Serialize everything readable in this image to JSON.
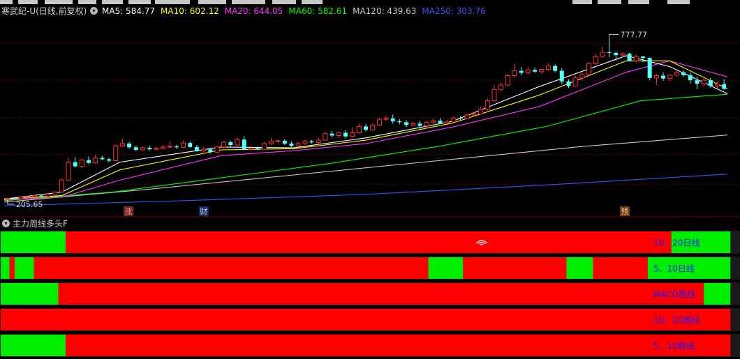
{
  "stock": {
    "title": "寒武纪-U(日线,前复权)",
    "toggle_glyph": "▾"
  },
  "ma_values": [
    {
      "key": "ma5",
      "label": "MA5: 584.77",
      "color": "#ffffff"
    },
    {
      "key": "ma10",
      "label": "MA10: 602.12",
      "color": "#ffff00"
    },
    {
      "key": "ma20",
      "label": "MA20: 644.05",
      "color": "#ff33ff"
    },
    {
      "key": "ma60",
      "label": "MA60: 582.61",
      "color": "#00ff00"
    },
    {
      "key": "ma120",
      "label": "MA120: 439.63",
      "color": "#c8c8c8"
    },
    {
      "key": "ma250",
      "label": "MA250: 303.76",
      "color": "#3355ff"
    }
  ],
  "colors": {
    "up": "#ff3232",
    "down": "#54ffff",
    "signal_red": "#ff0000",
    "signal_green": "#00ee00",
    "signal_label": "#1a1aff",
    "grid": "#7a0000"
  },
  "chart_data": {
    "type": "candlestick",
    "ylim": [
      190,
      840
    ],
    "high_label": "777.77",
    "low_label": "205.65",
    "candles": [
      [
        216,
        218,
        212,
        220
      ],
      [
        218,
        217,
        214,
        221
      ],
      [
        217,
        222,
        215,
        224
      ],
      [
        222,
        224,
        220,
        226
      ],
      [
        224,
        228,
        222,
        230
      ],
      [
        228,
        225,
        223,
        231
      ],
      [
        225,
        233,
        224,
        236
      ],
      [
        233,
        240,
        231,
        242
      ],
      [
        240,
        282,
        238,
        290
      ],
      [
        282,
        345,
        280,
        360
      ],
      [
        345,
        330,
        326,
        362
      ],
      [
        330,
        352,
        324,
        358
      ],
      [
        352,
        342,
        338,
        365
      ],
      [
        342,
        360,
        340,
        371
      ],
      [
        360,
        355,
        352,
        367
      ],
      [
        355,
        350,
        345,
        360
      ],
      [
        350,
        402,
        348,
        408
      ],
      [
        402,
        410,
        398,
        428
      ],
      [
        410,
        397,
        392,
        416
      ],
      [
        397,
        388,
        384,
        402
      ],
      [
        388,
        395,
        384,
        400
      ],
      [
        395,
        390,
        386,
        403
      ],
      [
        390,
        393,
        387,
        398
      ],
      [
        393,
        398,
        390,
        405
      ],
      [
        398,
        400,
        394,
        418
      ],
      [
        400,
        397,
        392,
        406
      ],
      [
        397,
        412,
        394,
        420
      ],
      [
        412,
        398,
        395,
        418
      ],
      [
        398,
        384,
        380,
        405
      ],
      [
        384,
        390,
        380,
        400
      ],
      [
        390,
        380,
        376,
        395
      ],
      [
        380,
        398,
        378,
        403
      ],
      [
        398,
        415,
        392,
        420
      ],
      [
        415,
        405,
        398,
        420
      ],
      [
        405,
        424,
        402,
        432
      ],
      [
        424,
        390,
        386,
        436
      ],
      [
        390,
        394,
        384,
        402
      ],
      [
        394,
        390,
        386,
        400
      ],
      [
        390,
        410,
        388,
        416
      ],
      [
        410,
        418,
        405,
        430
      ],
      [
        418,
        420,
        413,
        424
      ],
      [
        420,
        410,
        405,
        425
      ],
      [
        410,
        402,
        398,
        418
      ],
      [
        402,
        410,
        398,
        418
      ],
      [
        410,
        418,
        405,
        424
      ],
      [
        418,
        414,
        410,
        422
      ],
      [
        414,
        422,
        410,
        432
      ],
      [
        422,
        445,
        420,
        450
      ],
      [
        445,
        438,
        432,
        455
      ],
      [
        438,
        448,
        430,
        452
      ],
      [
        448,
        435,
        428,
        458
      ],
      [
        435,
        448,
        432,
        468
      ],
      [
        448,
        470,
        445,
        480
      ],
      [
        470,
        458,
        452,
        478
      ],
      [
        458,
        475,
        455,
        480
      ],
      [
        475,
        495,
        472,
        500
      ],
      [
        495,
        498,
        490,
        508
      ],
      [
        498,
        488,
        480,
        512
      ],
      [
        488,
        485,
        478,
        495
      ],
      [
        485,
        475,
        468,
        492
      ],
      [
        475,
        480,
        470,
        488
      ],
      [
        480,
        472,
        460,
        490
      ],
      [
        472,
        485,
        462,
        490
      ],
      [
        485,
        490,
        478,
        498
      ],
      [
        490,
        482,
        478,
        500
      ],
      [
        482,
        486,
        480,
        494
      ],
      [
        486,
        500,
        484,
        505
      ],
      [
        500,
        498,
        492,
        506
      ],
      [
        498,
        510,
        496,
        515
      ],
      [
        510,
        514,
        505,
        520
      ],
      [
        514,
        530,
        512,
        540
      ],
      [
        530,
        560,
        525,
        570
      ],
      [
        560,
        600,
        555,
        615
      ],
      [
        600,
        615,
        592,
        625
      ],
      [
        615,
        648,
        610,
        655
      ],
      [
        648,
        665,
        640,
        690
      ],
      [
        665,
        658,
        650,
        678
      ],
      [
        658,
        668,
        652,
        680
      ],
      [
        668,
        662,
        658,
        676
      ],
      [
        662,
        670,
        655,
        672
      ],
      [
        670,
        682,
        665,
        690
      ],
      [
        682,
        665,
        660,
        688
      ],
      [
        665,
        628,
        618,
        675
      ],
      [
        628,
        612,
        605,
        635
      ],
      [
        612,
        640,
        610,
        650
      ],
      [
        640,
        652,
        632,
        660
      ],
      [
        652,
        690,
        648,
        695
      ],
      [
        690,
        715,
        685,
        725
      ],
      [
        715,
        730,
        710,
        750
      ],
      [
        730,
        728,
        712,
        778
      ],
      [
        728,
        720,
        700,
        732
      ],
      [
        720,
        725,
        712,
        730
      ],
      [
        725,
        700,
        698,
        728
      ],
      [
        700,
        715,
        694,
        722
      ],
      [
        715,
        710,
        695,
        718
      ],
      [
        710,
        640,
        632,
        712
      ],
      [
        640,
        648,
        615,
        655
      ],
      [
        648,
        638,
        630,
        660
      ],
      [
        638,
        650,
        630,
        654
      ],
      [
        650,
        660,
        645,
        665
      ],
      [
        660,
        650,
        645,
        668
      ],
      [
        650,
        632,
        620,
        660
      ],
      [
        632,
        620,
        600,
        645
      ],
      [
        620,
        632,
        610,
        640
      ],
      [
        632,
        612,
        606,
        640
      ],
      [
        612,
        618,
        605,
        628
      ],
      [
        618,
        602,
        598,
        635
      ]
    ],
    "ma_lines": {
      "ma5": [
        [
          0,
          216
        ],
        [
          0.08,
          240
        ],
        [
          0.16,
          345
        ],
        [
          0.3,
          398
        ],
        [
          0.4,
          395
        ],
        [
          0.5,
          430
        ],
        [
          0.62,
          488
        ],
        [
          0.74,
          610
        ],
        [
          0.86,
          718
        ],
        [
          0.92,
          680
        ],
        [
          1.0,
          585
        ]
      ],
      "ma10": [
        [
          0,
          215
        ],
        [
          0.08,
          228
        ],
        [
          0.16,
          318
        ],
        [
          0.3,
          388
        ],
        [
          0.4,
          392
        ],
        [
          0.5,
          422
        ],
        [
          0.62,
          482
        ],
        [
          0.74,
          580
        ],
        [
          0.86,
          700
        ],
        [
          0.92,
          700
        ],
        [
          1.0,
          602
        ]
      ],
      "ma20": [
        [
          0,
          213
        ],
        [
          0.08,
          222
        ],
        [
          0.16,
          282
        ],
        [
          0.3,
          368
        ],
        [
          0.4,
          385
        ],
        [
          0.5,
          410
        ],
        [
          0.62,
          468
        ],
        [
          0.74,
          540
        ],
        [
          0.86,
          660
        ],
        [
          0.92,
          700
        ],
        [
          1.0,
          644
        ]
      ],
      "ma60": [
        [
          0,
          210
        ],
        [
          0.15,
          240
        ],
        [
          0.3,
          290
        ],
        [
          0.45,
          340
        ],
        [
          0.6,
          400
        ],
        [
          0.75,
          470
        ],
        [
          0.88,
          560
        ],
        [
          1.0,
          583
        ]
      ],
      "ma120": [
        [
          0,
          205
        ],
        [
          0.2,
          250
        ],
        [
          0.4,
          300
        ],
        [
          0.6,
          350
        ],
        [
          0.8,
          400
        ],
        [
          1.0,
          440
        ]
      ],
      "ma250": [
        [
          0,
          192
        ],
        [
          0.25,
          210
        ],
        [
          0.5,
          232
        ],
        [
          0.75,
          265
        ],
        [
          1.0,
          303
        ]
      ]
    },
    "event_markers": [
      {
        "label": "涨",
        "at": 0.172,
        "bg": "#6b2a2a",
        "fg": "#ff8080"
      },
      {
        "label": "财",
        "at": 0.276,
        "bg": "#1a2a55",
        "fg": "#9fd0ff"
      },
      {
        "label": "预",
        "at": 0.858,
        "bg": "#6b3a1a",
        "fg": "#ffcc80"
      }
    ]
  },
  "indicator": {
    "name": "主力周线多头F",
    "rows": [
      {
        "label": "10、20日线",
        "segments": [
          [
            "g",
            0,
            0.088
          ],
          [
            "r",
            0.088,
            0.908
          ],
          [
            "g",
            0.908,
            0.988
          ]
        ]
      },
      {
        "label": "5、10日线",
        "segments": [
          [
            "g",
            0,
            0.012
          ],
          [
            "r",
            0.012,
            0.019
          ],
          [
            "g",
            0.019,
            0.045
          ],
          [
            "r",
            0.045,
            0.579
          ],
          [
            "g",
            0.579,
            0.626
          ],
          [
            "r",
            0.626,
            0.766
          ],
          [
            "g",
            0.766,
            0.802
          ],
          [
            "r",
            0.802,
            0.876
          ],
          [
            "g",
            0.876,
            0.988
          ]
        ]
      },
      {
        "label": "MACD周线",
        "segments": [
          [
            "g",
            0,
            0.078
          ],
          [
            "r",
            0.078,
            0.952
          ],
          [
            "g",
            0.952,
            0.988
          ]
        ]
      },
      {
        "label": "10、20周线",
        "segments": [
          [
            "r",
            0,
            0.988
          ]
        ]
      },
      {
        "label": "5、10周线",
        "segments": [
          [
            "g",
            0,
            0.088
          ],
          [
            "r",
            0.088,
            0.988
          ]
        ]
      }
    ]
  }
}
